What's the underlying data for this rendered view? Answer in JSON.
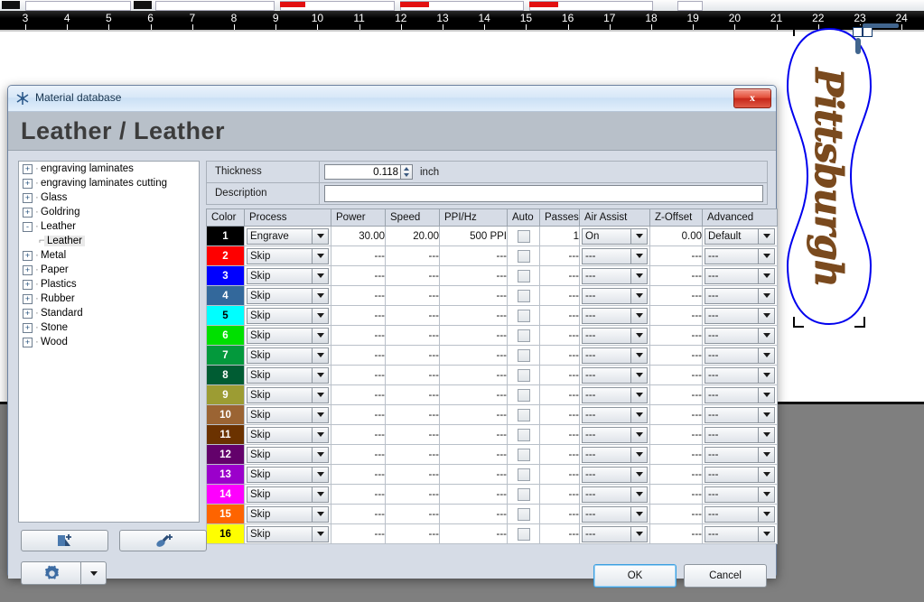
{
  "ruler": {
    "labels": [
      "3",
      "4",
      "5",
      "6",
      "7",
      "8",
      "9",
      "10",
      "11",
      "12",
      "13",
      "14",
      "15",
      "16",
      "17",
      "18",
      "19",
      "20",
      "21",
      "22",
      "23",
      "24"
    ],
    "unit_start": 3,
    "unit_end": 24
  },
  "artwork": {
    "text": "Pittsburgh",
    "text_color": "#7a4a1e",
    "outline_color": "#0000ee"
  },
  "dialog": {
    "title": "Material database",
    "close_label": "x",
    "heading": "Leather / Leather"
  },
  "tree": {
    "items": [
      {
        "label": "engraving laminates",
        "expander": "+",
        "level": 0,
        "selected": false
      },
      {
        "label": "engraving laminates cutting",
        "expander": "+",
        "level": 0,
        "selected": false
      },
      {
        "label": "Glass",
        "expander": "+",
        "level": 0,
        "selected": false
      },
      {
        "label": "Goldring",
        "expander": "+",
        "level": 0,
        "selected": false
      },
      {
        "label": "Leather",
        "expander": "-",
        "level": 0,
        "selected": false
      },
      {
        "label": "Leather",
        "expander": "",
        "level": 1,
        "selected": true
      },
      {
        "label": "Metal",
        "expander": "+",
        "level": 0,
        "selected": false
      },
      {
        "label": "Paper",
        "expander": "+",
        "level": 0,
        "selected": false
      },
      {
        "label": "Plastics",
        "expander": "+",
        "level": 0,
        "selected": false
      },
      {
        "label": "Rubber",
        "expander": "+",
        "level": 0,
        "selected": false
      },
      {
        "label": "Standard",
        "expander": "+",
        "level": 0,
        "selected": false
      },
      {
        "label": "Stone",
        "expander": "+",
        "level": 0,
        "selected": false
      },
      {
        "label": "Wood",
        "expander": "+",
        "level": 0,
        "selected": false
      }
    ]
  },
  "fields": {
    "thickness_label": "Thickness",
    "thickness_value": "0.118",
    "thickness_unit": "inch",
    "description_label": "Description",
    "description_value": "",
    "description_placeholder": ""
  },
  "table": {
    "headers": [
      "Color",
      "Process",
      "Power",
      "Speed",
      "PPI/Hz",
      "Auto",
      "Passes",
      "Air Assist",
      "Z-Offset",
      "Advanced"
    ],
    "rows": [
      {
        "index": "1",
        "swatch": "#000000",
        "light": false,
        "process": "Engrave",
        "power": "30.00",
        "speed": "20.00",
        "ppi": "500 PPI",
        "auto": false,
        "passes": "1",
        "air": "On",
        "zoffset": "0.00",
        "advanced": "Default"
      },
      {
        "index": "2",
        "swatch": "#fe0000",
        "light": false,
        "process": "Skip",
        "power": "---",
        "speed": "---",
        "ppi": "---",
        "auto": false,
        "passes": "---",
        "air": "---",
        "zoffset": "---",
        "advanced": "---"
      },
      {
        "index": "3",
        "swatch": "#0000fe",
        "light": false,
        "process": "Skip",
        "power": "---",
        "speed": "---",
        "ppi": "---",
        "auto": false,
        "passes": "---",
        "air": "---",
        "zoffset": "---",
        "advanced": "---"
      },
      {
        "index": "4",
        "swatch": "#33689b",
        "light": false,
        "process": "Skip",
        "power": "---",
        "speed": "---",
        "ppi": "---",
        "auto": false,
        "passes": "---",
        "air": "---",
        "zoffset": "---",
        "advanced": "---"
      },
      {
        "index": "5",
        "swatch": "#00ffff",
        "light": true,
        "process": "Skip",
        "power": "---",
        "speed": "---",
        "ppi": "---",
        "auto": false,
        "passes": "---",
        "air": "---",
        "zoffset": "---",
        "advanced": "---"
      },
      {
        "index": "6",
        "swatch": "#00e000",
        "light": false,
        "process": "Skip",
        "power": "---",
        "speed": "---",
        "ppi": "---",
        "auto": false,
        "passes": "---",
        "air": "---",
        "zoffset": "---",
        "advanced": "---"
      },
      {
        "index": "7",
        "swatch": "#03993c",
        "light": false,
        "process": "Skip",
        "power": "---",
        "speed": "---",
        "ppi": "---",
        "auto": false,
        "passes": "---",
        "air": "---",
        "zoffset": "---",
        "advanced": "---"
      },
      {
        "index": "8",
        "swatch": "#005c33",
        "light": false,
        "process": "Skip",
        "power": "---",
        "speed": "---",
        "ppi": "---",
        "auto": false,
        "passes": "---",
        "air": "---",
        "zoffset": "---",
        "advanced": "---"
      },
      {
        "index": "9",
        "swatch": "#9c9c33",
        "light": false,
        "process": "Skip",
        "power": "---",
        "speed": "---",
        "ppi": "---",
        "auto": false,
        "passes": "---",
        "air": "---",
        "zoffset": "---",
        "advanced": "---"
      },
      {
        "index": "10",
        "swatch": "#9b6433",
        "light": false,
        "process": "Skip",
        "power": "---",
        "speed": "---",
        "ppi": "---",
        "auto": false,
        "passes": "---",
        "air": "---",
        "zoffset": "---",
        "advanced": "---"
      },
      {
        "index": "11",
        "swatch": "#6b3200",
        "light": false,
        "process": "Skip",
        "power": "---",
        "speed": "---",
        "ppi": "---",
        "auto": false,
        "passes": "---",
        "air": "---",
        "zoffset": "---",
        "advanced": "---"
      },
      {
        "index": "12",
        "swatch": "#63016b",
        "light": false,
        "process": "Skip",
        "power": "---",
        "speed": "---",
        "ppi": "---",
        "auto": false,
        "passes": "---",
        "air": "---",
        "zoffset": "---",
        "advanced": "---"
      },
      {
        "index": "13",
        "swatch": "#9b00cb",
        "light": false,
        "process": "Skip",
        "power": "---",
        "speed": "---",
        "ppi": "---",
        "auto": false,
        "passes": "---",
        "air": "---",
        "zoffset": "---",
        "advanced": "---"
      },
      {
        "index": "14",
        "swatch": "#fe00fe",
        "light": false,
        "process": "Skip",
        "power": "---",
        "speed": "---",
        "ppi": "---",
        "auto": false,
        "passes": "---",
        "air": "---",
        "zoffset": "---",
        "advanced": "---"
      },
      {
        "index": "15",
        "swatch": "#fe6400",
        "light": false,
        "process": "Skip",
        "power": "---",
        "speed": "---",
        "ppi": "---",
        "auto": false,
        "passes": "---",
        "air": "---",
        "zoffset": "---",
        "advanced": "---"
      },
      {
        "index": "16",
        "swatch": "#fefe00",
        "light": true,
        "process": "Skip",
        "power": "---",
        "speed": "---",
        "ppi": "---",
        "auto": false,
        "passes": "---",
        "air": "---",
        "zoffset": "---",
        "advanced": "---"
      }
    ]
  },
  "buttons": {
    "new_material_icon": "new-material-icon",
    "new_entry_icon": "new-entry-icon",
    "settings_icon": "gear-icon",
    "settings_caret": "chevron-down-icon",
    "ok": "OK",
    "cancel": "Cancel"
  }
}
